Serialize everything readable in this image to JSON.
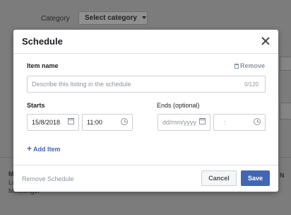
{
  "background": {
    "category_label": "Category",
    "category_select": "Select category",
    "bottom_left_title": "M",
    "bottom_left_line2": "Le",
    "bottom_left_line3": "Messenger",
    "right_letter": "N"
  },
  "modal": {
    "title": "Schedule",
    "item_name_label": "Item name",
    "remove_label": "Remove",
    "item_name_placeholder": "Describe this listing in the schedule",
    "item_name_counter": "0/120",
    "starts_label": "Starts",
    "start_date": "15/8/2018",
    "start_time": "11:00",
    "ends_label": "Ends (optional)",
    "end_date_placeholder": "dd/mm/yyyy",
    "end_time_placeholder": ":",
    "add_item": "Add Item",
    "remove_schedule": "Remove Schedule",
    "cancel": "Cancel",
    "save": "Save"
  },
  "colors": {
    "accent": "#4267b2",
    "overlay": "#7c7c7c"
  }
}
